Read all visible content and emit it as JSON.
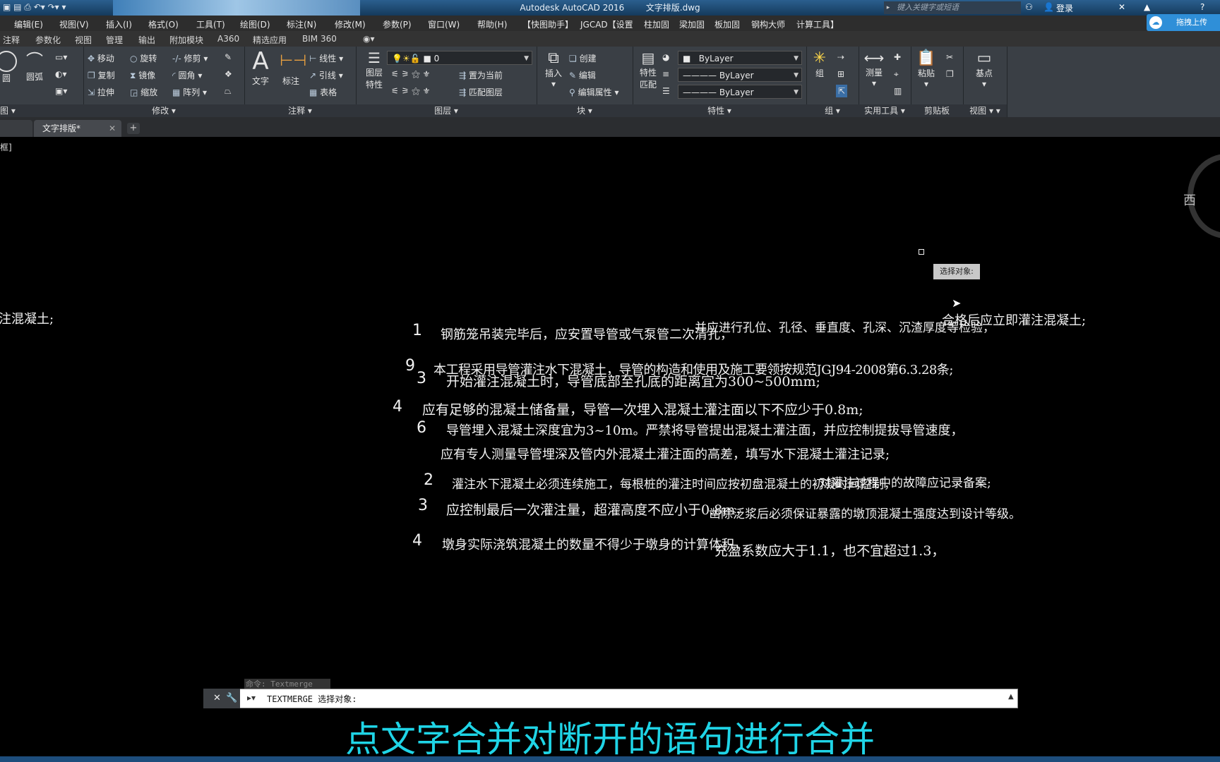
{
  "titlebar": {
    "title": "Autodesk AutoCAD 2016",
    "filename": "文字排版.dwg",
    "search_placeholder": "键入关键字或短语",
    "login": "登录"
  },
  "upload_label": "拖拽上传",
  "menu": [
    "编辑(E)",
    "视图(V)",
    "插入(I)",
    "格式(O)",
    "工具(T)",
    "绘图(D)",
    "标注(N)",
    "修改(M)",
    "参数(P)",
    "窗口(W)",
    "帮助(H)",
    "【快图助手】",
    "JGCAD【设置",
    "柱加固",
    "梁加固",
    "板加固",
    "钢构大师",
    "计算工具】"
  ],
  "ribbon_tabs": [
    "注释",
    "参数化",
    "视图",
    "管理",
    "输出",
    "附加模块",
    "A360",
    "精选应用",
    "BIM 360"
  ],
  "ribbon": {
    "draw": {
      "circle": "圆",
      "arc": "圆弧",
      "title": "图"
    },
    "modify": {
      "move": "移动",
      "rotate": "旋转",
      "trim": "修剪",
      "copy": "复制",
      "mirror": "镜像",
      "fillet": "圆角",
      "stretch": "拉伸",
      "scale": "缩放",
      "array": "阵列",
      "title": "修改"
    },
    "annotation": {
      "text": "文字",
      "dimension": "标注",
      "linear": "线性",
      "leader": "引线",
      "table": "表格",
      "title": "注释"
    },
    "layers": {
      "props": "图层\n特性",
      "current_layer": "0",
      "set_current": "置为当前",
      "match_layer": "匹配图层",
      "title": "图层"
    },
    "block": {
      "insert": "插入",
      "create": "创建",
      "edit": "编辑",
      "edit_attr": "编辑属性",
      "title": "块"
    },
    "properties": {
      "match": "特性\n匹配",
      "color": "ByLayer",
      "linetype": "ByLayer",
      "lineweight": "ByLayer",
      "title": "特性"
    },
    "groups": {
      "group": "组",
      "title": "组"
    },
    "utilities": {
      "measure": "测量",
      "title": "实用工具"
    },
    "clipboard": {
      "paste": "粘贴",
      "title": "剪贴板"
    },
    "view": {
      "base": "基点",
      "title": "视图"
    }
  },
  "doc_tab": "文字排版*",
  "canvas": {
    "corner_label": "框]",
    "left_clip": "注混凝土;",
    "tooltip": "选择对象:",
    "viewcube_label": "西",
    "lines": [
      {
        "num": "1",
        "text": "钢筋笼吊装完毕后，应安置导管或气泵管二次清孔，"
      },
      {
        "text": "并应进行孔位、孔径、垂直度、孔深、沉渣厚度等检验，"
      },
      {
        "text": "合格后应立即灌注混凝土;"
      },
      {
        "num": "9",
        "text": "本工程采用导管灌注水下混凝土，导管的构造和使用及施工要领按规范JGJ94-2008第6.3.28条;"
      },
      {
        "num": "3",
        "text": "开始灌注混凝土时，导管底部至孔底的距离宜为300~500mm;"
      },
      {
        "num": "4",
        "text": "应有足够的混凝土储备量，导管一次埋入混凝土灌注面以下不应少于0.8m;"
      },
      {
        "num": "6",
        "text": "导管埋入混凝土深度宜为3~10m。严禁将导管提出混凝土灌注面，并应控制提拔导管速度，"
      },
      {
        "text": "应有专人测量导管埋深及管内外混凝土灌注面的高差，填写水下混凝土灌注记录;"
      },
      {
        "num": "2",
        "text": "灌注水下混凝土必须连续施工，每根桩的灌注时间应按初盘混凝土的初凝时间控制，"
      },
      {
        "text": "对灌注过程中的故障应记录备案;"
      },
      {
        "num": "3",
        "text": "应控制最后一次灌注量，超灌高度不应小于0.8m，"
      },
      {
        "text": "凿除泛浆后必须保证暴露的墩顶混凝土强度达到设计等级。"
      },
      {
        "num": "4",
        "text": "墩身实际浇筑混凝土的数量不得少于墩身的计算体积，"
      },
      {
        "text": "充盈系数应大于1.1，也不宜超过1.3，"
      }
    ]
  },
  "command": {
    "history": "命令: Textmerge",
    "current": "TEXTMERGE 选择对象:"
  },
  "subtitle": "点文字合并对断开的语句进行合并"
}
